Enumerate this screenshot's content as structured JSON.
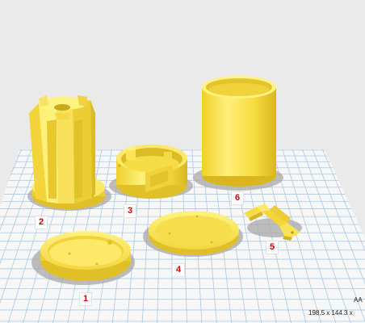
{
  "viewport": {
    "background": "#eaeaea",
    "build_plate_color": "#f7f7f7",
    "grid_color": "#aac8e6",
    "part_color": "#ffeb5a",
    "label_color": "#d40000"
  },
  "part_labels": {
    "p1": "1",
    "p2": "2",
    "p3": "3",
    "p4": "4",
    "p5": "5",
    "p6": "6"
  },
  "status": {
    "profile_abbrev": "AA",
    "dimensions": "198.5 x 144.3 x"
  }
}
